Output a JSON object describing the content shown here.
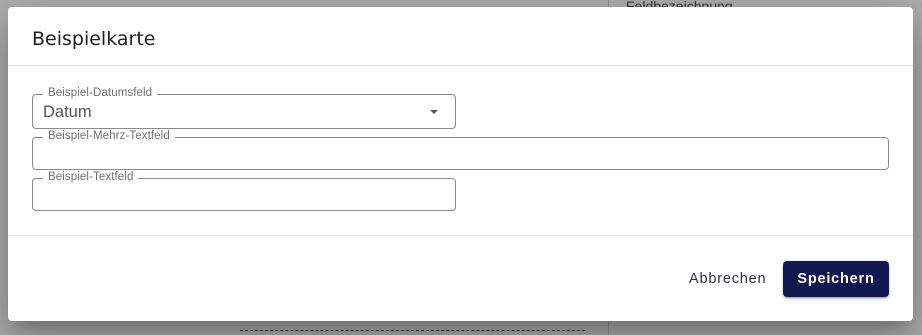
{
  "background": {
    "right_panel_label": "Feldbezeichnung"
  },
  "dialog": {
    "title": "Beispielkarte",
    "fields": {
      "date": {
        "label": "Beispiel-Datumsfeld",
        "value": "Datum",
        "icon": "dropdown-arrow-icon"
      },
      "multitext": {
        "label": "Beispiel-Mehrz-Textfeld",
        "value": ""
      },
      "text": {
        "label": "Beispiel-Textfeld",
        "value": ""
      }
    },
    "actions": {
      "cancel_label": "Abbrechen",
      "save_label": "Speichern"
    },
    "colors": {
      "primary": "#141850",
      "scrim": "rgba(0,0,0,0.32)"
    }
  }
}
